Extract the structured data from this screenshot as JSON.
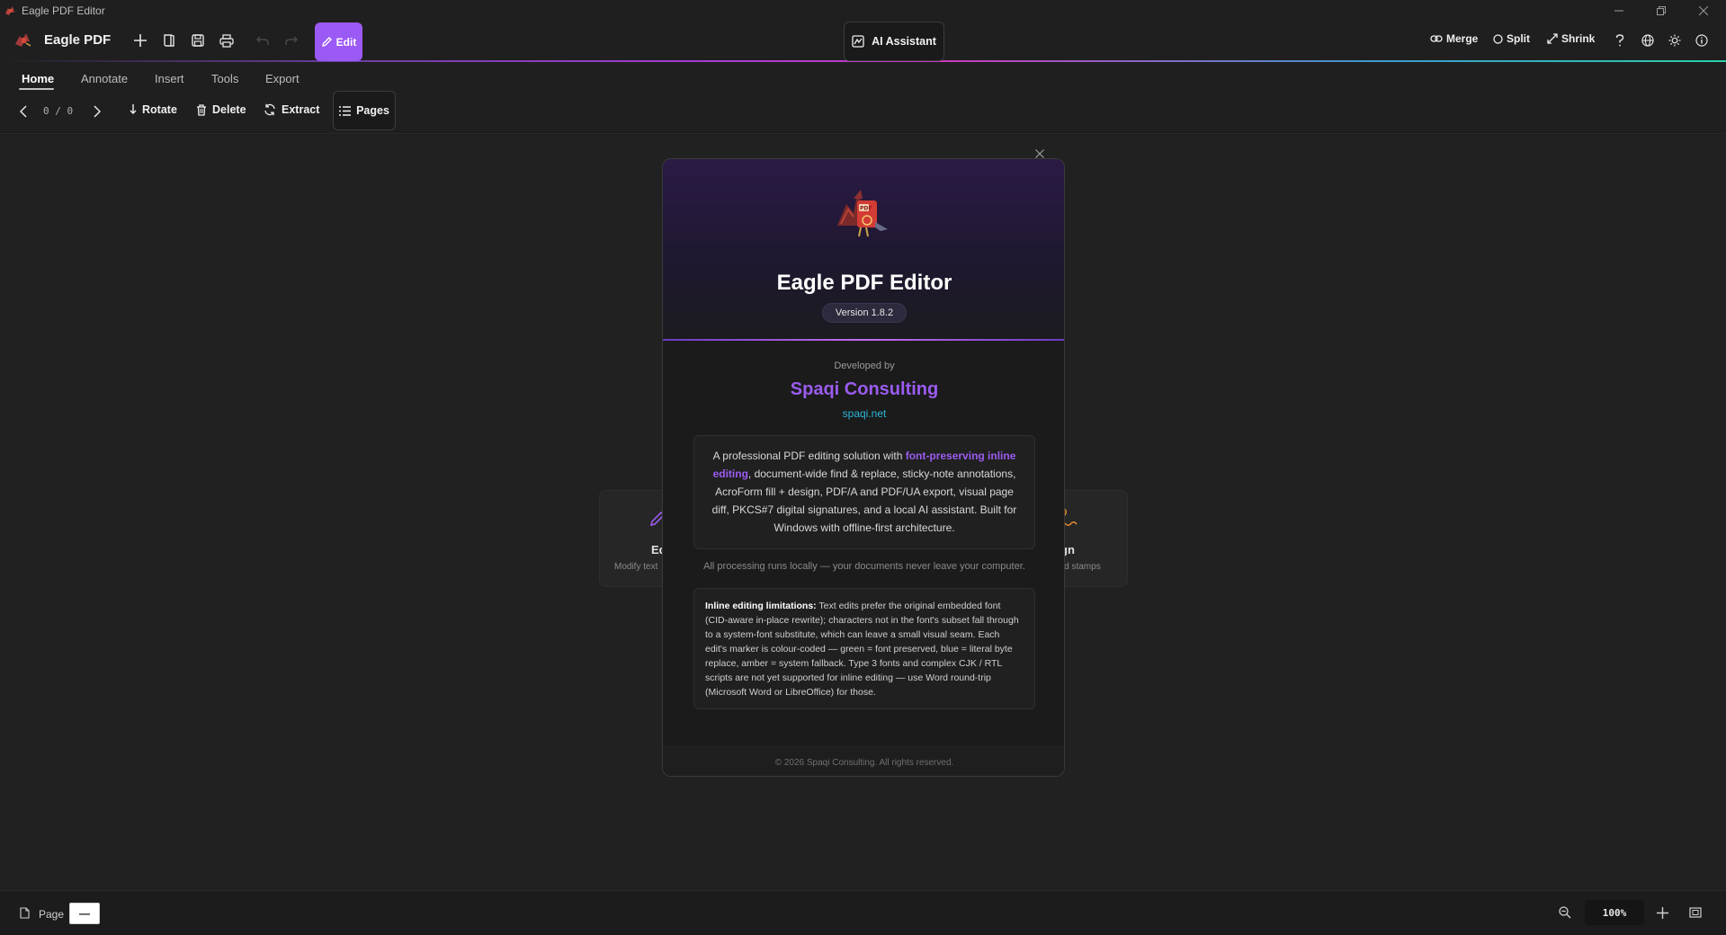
{
  "window": {
    "title": "Eagle PDF Editor"
  },
  "toolbar": {
    "brand": "Eagle PDF",
    "edit_label": "Edit",
    "ai_label": "AI Assistant",
    "merge_label": "Merge",
    "split_label": "Split",
    "shrink_label": "Shrink"
  },
  "tabs": [
    {
      "label": "Home",
      "active": true
    },
    {
      "label": "Annotate",
      "active": false
    },
    {
      "label": "Insert",
      "active": false
    },
    {
      "label": "Tools",
      "active": false
    },
    {
      "label": "Export",
      "active": false
    }
  ],
  "pagebar": {
    "counter": "0 / 0",
    "rotate_label": "Rotate",
    "delete_label": "Delete",
    "extract_label": "Extract",
    "pages_label": "Pages"
  },
  "background_cards": [
    {
      "title": "Ed",
      "subtitle": "Modify text"
    },
    {
      "title": "gn",
      "subtitle": "and stamps"
    }
  ],
  "about": {
    "title": "Eagle PDF Editor",
    "version": "Version 1.8.2",
    "developed_by": "Developed by",
    "developer": "Spaqi Consulting",
    "website": "spaqi.net",
    "desc_pre": "A professional PDF editing solution with ",
    "desc_highlight": "font-preserving inline editing",
    "desc_post": ", document-wide find & replace, sticky-note annotations, AcroForm fill + design, PDF/A and PDF/UA export, visual page diff, PKCS#7 digital signatures, and a local AI assistant. Built for Windows with offline-first architecture.",
    "local_note": "All processing runs locally — your documents never leave your computer.",
    "limits_label": "Inline editing limitations:",
    "limits_text": " Text edits prefer the original embedded font (CID-aware in-place rewrite); characters not in the font's subset fall through to a system-font substitute, which can leave a small visual seam. Each edit's marker is colour-coded — green = font preserved, blue = literal byte replace, amber = system fallback. Type 3 fonts and complex CJK / RTL scripts are not yet supported for inline editing — use Word round-trip (Microsoft Word or LibreOffice) for those.",
    "copyright": "© 2026 Spaqi Consulting. All rights reserved."
  },
  "statusbar": {
    "page_label": "Page",
    "page_value": "—",
    "zoom": "100%"
  },
  "colors": {
    "accent": "#9b5cf0",
    "link": "#2bb6d8",
    "background": "#212121"
  }
}
